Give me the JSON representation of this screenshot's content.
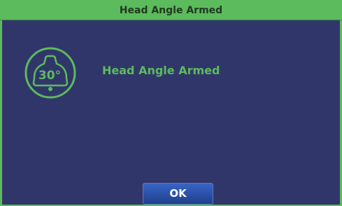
{
  "dialog": {
    "title": "Head Angle Armed",
    "message": "Head Angle Armed",
    "icon_label": "30°",
    "icon_name": "head-angle-bell-icon",
    "ok_label": "OK"
  },
  "colors": {
    "accent": "#5cbb5c",
    "background": "#31366a",
    "button": "#2c53aa"
  }
}
